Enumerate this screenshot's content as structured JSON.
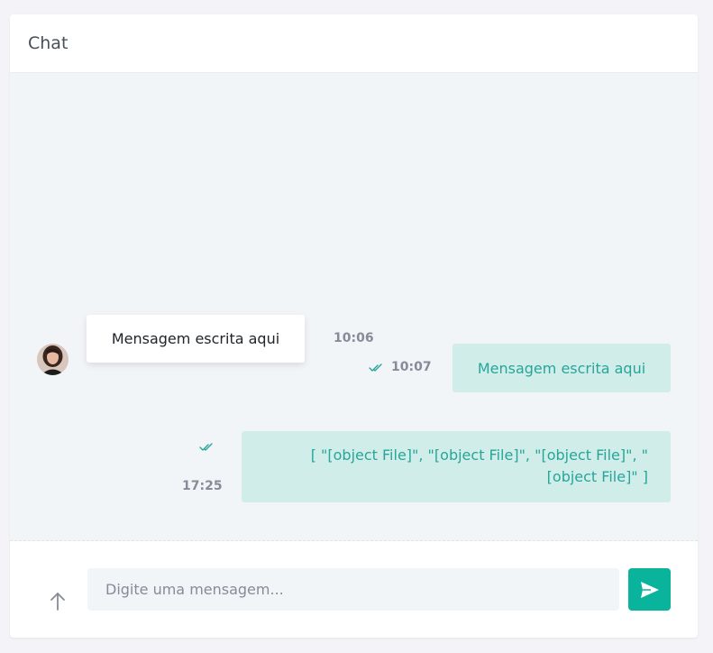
{
  "header": {
    "title": "Chat"
  },
  "messages": [
    {
      "direction": "incoming",
      "text": "Mensagem escrita aqui",
      "time": "10:06"
    },
    {
      "direction": "outgoing",
      "text": "Mensagem escrita aqui",
      "time": "10:07",
      "status_icon": "double-check-icon"
    },
    {
      "direction": "outgoing",
      "text": "[ \"[object File]\", \"[object File]\", \"[object File]\", \"[object File]\" ]",
      "time": "17:25",
      "status_icon": "double-check-icon"
    }
  ],
  "composer": {
    "placeholder": "Digite uma mensagem...",
    "upload_icon": "arrow-up-icon",
    "send_icon": "send-icon"
  },
  "colors": {
    "accent": "#0ab39c",
    "outgoing_bubble": "#d1ede9",
    "outgoing_text": "#26a69a",
    "chat_background": "#f2f5f8"
  }
}
